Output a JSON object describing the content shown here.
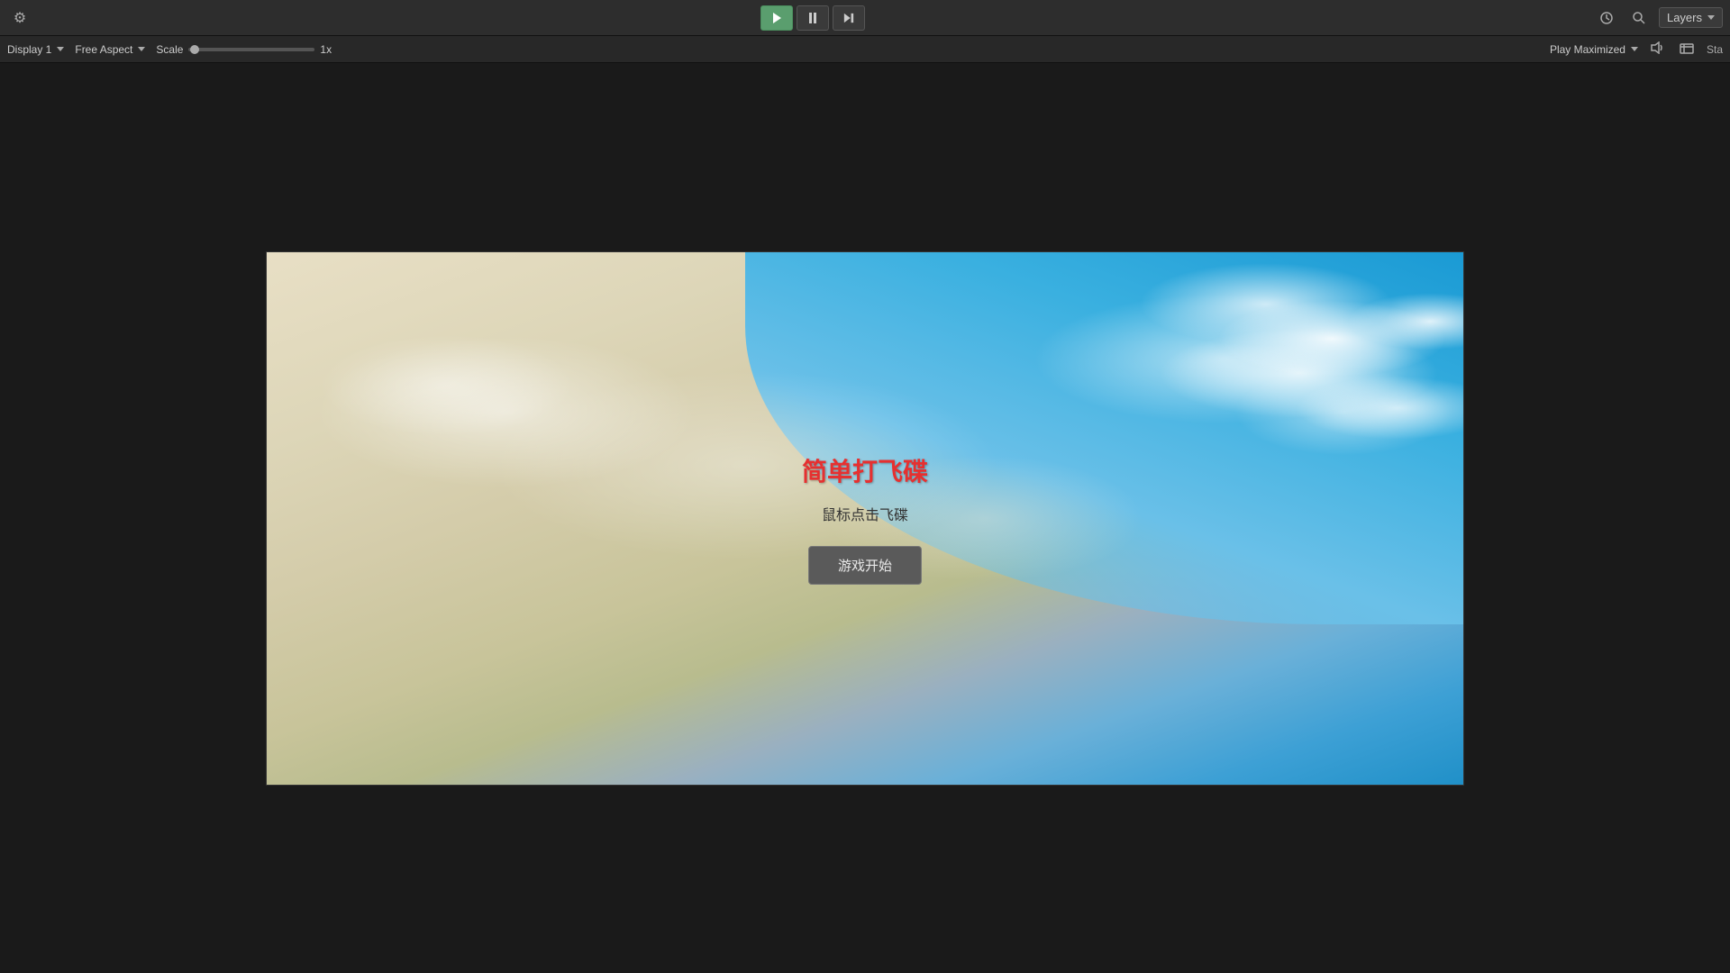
{
  "toolbar": {
    "play_label": "▶",
    "pause_label": "⏸",
    "step_label": "⏭",
    "history_icon": "🕐",
    "search_icon": "🔍",
    "layers_label": "Layers",
    "settings_icon": "⚙"
  },
  "secondary_toolbar": {
    "display_label": "Display 1",
    "aspect_label": "Free Aspect",
    "scale_label": "Scale",
    "scale_value": "1x",
    "play_maximized_label": "Play Maximized",
    "audio_icon": "🔊",
    "stats_label": "Sta"
  },
  "game": {
    "title": "简单打飞碟",
    "subtitle": "鼠标点击飞碟",
    "start_button": "游戏开始"
  }
}
